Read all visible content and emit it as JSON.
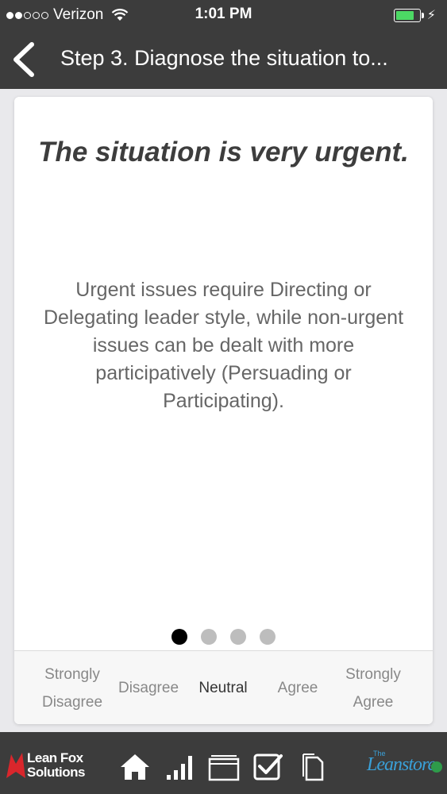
{
  "status": {
    "carrier": "Verizon",
    "time": "1:01 PM",
    "battery_level": 0.8
  },
  "nav": {
    "title": "Step 3. Diagnose the situation to..."
  },
  "card": {
    "title": "The situation is very urgent.",
    "body": "Urgent issues require Directing or Delegating leader style, while non-urgent issues can be dealt with more participatively (Persuading or Participating).",
    "page_index": 1,
    "page_count": 4
  },
  "rating": {
    "options": [
      {
        "label": "Strongly Disagree"
      },
      {
        "label": "Disagree"
      },
      {
        "label": "Neutral"
      },
      {
        "label": "Agree"
      },
      {
        "label": "Strongly Agree"
      }
    ],
    "selected": "Neutral"
  },
  "toolbar": {
    "brand_line1": "Lean Fox",
    "brand_line2": "Solutions",
    "store_small": "The",
    "store_name": "Leanstore",
    "icons": [
      "home-icon",
      "signal-bars-icon",
      "folder-icon",
      "checkbox-icon",
      "document-icon"
    ]
  },
  "colors": {
    "bar_bg": "#3c3c3c",
    "battery": "#4cd964",
    "active_dot": "#000000",
    "inactive_dot": "#bdbdbd"
  }
}
